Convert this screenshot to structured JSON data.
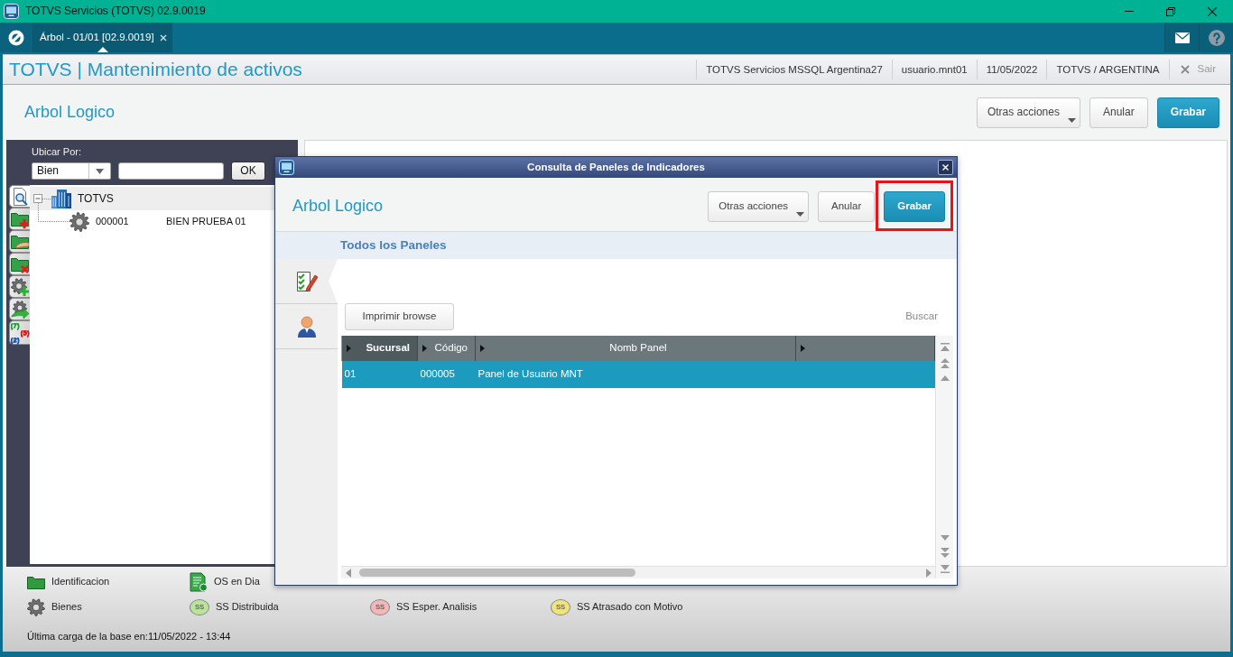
{
  "window": {
    "title": "TOTVS Servicios (TOTVS) 02.9.0019"
  },
  "tabs": [
    {
      "label": "Árbol - 01/01 [02.9.0019]",
      "selected": true,
      "closable": true
    }
  ],
  "header": {
    "title": "TOTVS | Mantenimiento de activos",
    "info": [
      "TOTVS Servicios MSSQL Argentina27",
      "usuario.mnt01",
      "11/05/2022",
      "TOTVS / ARGENTINA"
    ],
    "exit": "Sair"
  },
  "page": {
    "title": "Arbol Logico",
    "buttons": [
      {
        "label": "Otras acciones",
        "kind": "menu"
      },
      {
        "label": "Anular",
        "kind": "cancel"
      },
      {
        "label": "Grabar",
        "kind": "save"
      }
    ]
  },
  "locate": {
    "label": "Ubicar Por:",
    "filter": "Bien",
    "button": "OK"
  },
  "side_tabs": [
    {
      "kind": "search",
      "selected": true
    },
    {
      "kind": "folder-add",
      "selected": false
    },
    {
      "kind": "folder-hand",
      "selected": false
    },
    {
      "kind": "folder-remove",
      "selected": false
    },
    {
      "kind": "gear-add",
      "selected": false
    },
    {
      "kind": "gear-move",
      "selected": false
    },
    {
      "kind": "counts",
      "selected": false,
      "counts": [
        {
          "text": "(7)",
          "color": "#1e9c3c"
        },
        {
          "text": "(5)",
          "color": "#d01b1b"
        },
        {
          "text": "(2)",
          "color": "#1e4fa8"
        }
      ]
    }
  ],
  "tree": [
    {
      "kind": "company",
      "label": "TOTVS",
      "selected": true,
      "expanded": true,
      "children": [
        {
          "kind": "asset",
          "code": "000001",
          "label": "BIEN PRUEBA 01",
          "selected": false
        }
      ]
    }
  ],
  "dialog": {
    "title": "Consulta de Paneles de Indicadores",
    "heading": "Arbol Logico",
    "buttons": [
      {
        "label": "Otras acciones",
        "kind": "menu",
        "highlighted": false
      },
      {
        "label": "Anular",
        "kind": "cancel",
        "highlighted": false
      },
      {
        "label": "Grabar",
        "kind": "save",
        "highlighted": true
      }
    ],
    "section": "Todos los Paneles",
    "side_tabs": [
      {
        "kind": "checklist",
        "selected": true
      },
      {
        "kind": "user",
        "selected": false
      }
    ],
    "print_button": "Imprimir browse",
    "search_link": "Buscar",
    "table": {
      "columns": [
        {
          "label": "Sucursal",
          "selected": true
        },
        {
          "label": "Código",
          "selected": false
        },
        {
          "label": "Nomb Panel",
          "selected": false
        },
        {
          "selected": false
        }
      ],
      "rows": [
        {
          "cells": [
            "01",
            "000005",
            "Panel de Usuario MNT"
          ],
          "selected": true
        }
      ]
    }
  },
  "legend": {
    "rows": [
      [
        {
          "kind": "folder",
          "label": "Identificacion"
        },
        {
          "kind": "order",
          "label": "OS en Dia"
        }
      ],
      [
        {
          "kind": "gear",
          "label": "Bienes"
        },
        {
          "kind": "bubble",
          "badge": "SS",
          "color": "#b9e49a",
          "label": "SS Distribuida"
        },
        {
          "kind": "bubble",
          "badge": "SS",
          "color": "#f4b6b6",
          "label": "SS Esper. Analisis"
        },
        {
          "kind": "bubble",
          "badge": "SS",
          "color": "#efe37a",
          "label": "SS Atrasado con Motivo"
        }
      ]
    ],
    "status": "Última carga de la base en:11/05/2022 - 13:44"
  }
}
